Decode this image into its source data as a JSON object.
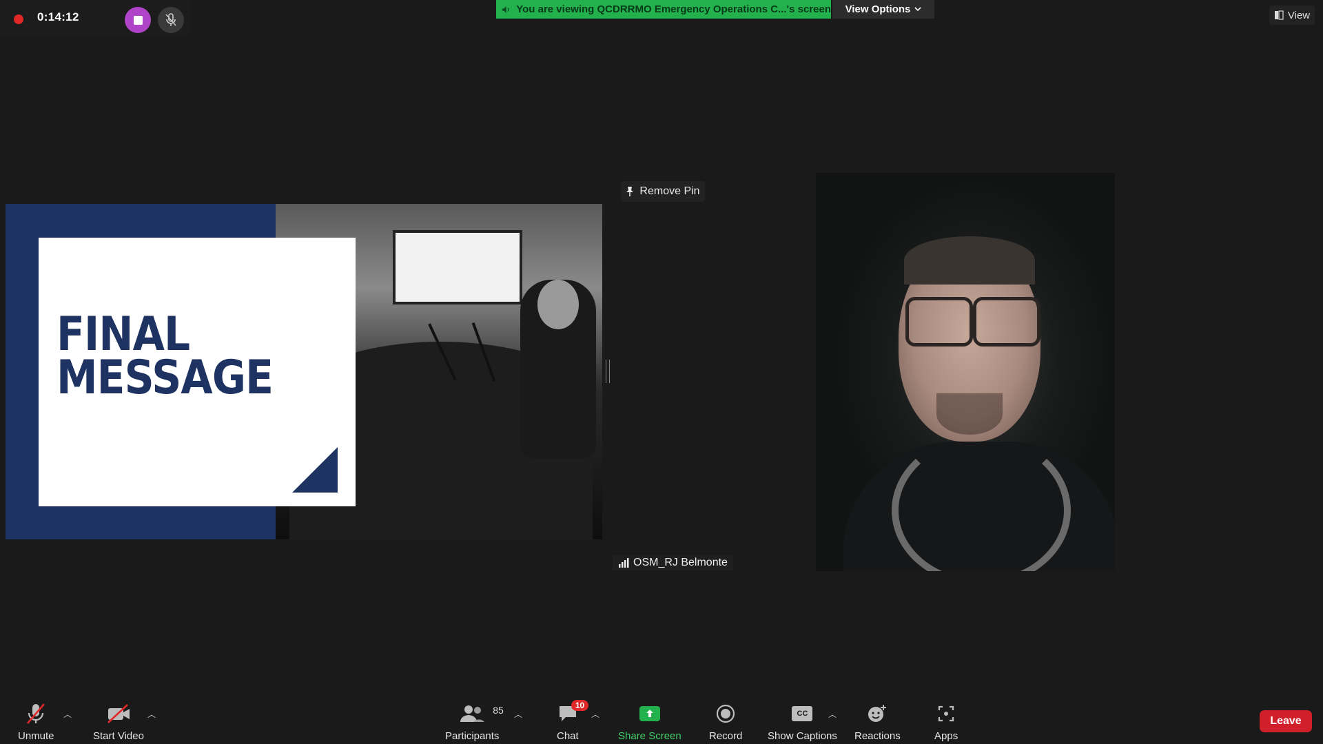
{
  "recording": {
    "timer": "0:14:12"
  },
  "banner": {
    "text": "You are viewing QCDRRMO Emergency Operations C...'s screen",
    "color": "#23b14d"
  },
  "view_options": {
    "label": "View Options"
  },
  "view": {
    "label": "View"
  },
  "shared_screen": {
    "slide_title_line1": "FINAL",
    "slide_title_line2": "MESSAGE",
    "slide_color": "#1e3361"
  },
  "pin": {
    "label": "Remove Pin"
  },
  "participant": {
    "name": "OSM_RJ Belmonte"
  },
  "toolbar": {
    "unmute": "Unmute",
    "start_video": "Start Video",
    "participants": "Participants",
    "participants_count": "85",
    "chat": "Chat",
    "chat_badge": "10",
    "share_screen": "Share Screen",
    "record": "Record",
    "show_captions": "Show Captions",
    "captions_icon_text": "CC",
    "reactions": "Reactions",
    "apps": "Apps",
    "leave": "Leave"
  },
  "colors": {
    "leave": "#d2202a",
    "record_dot": "#e02828",
    "stop_button": "#b044c8"
  }
}
